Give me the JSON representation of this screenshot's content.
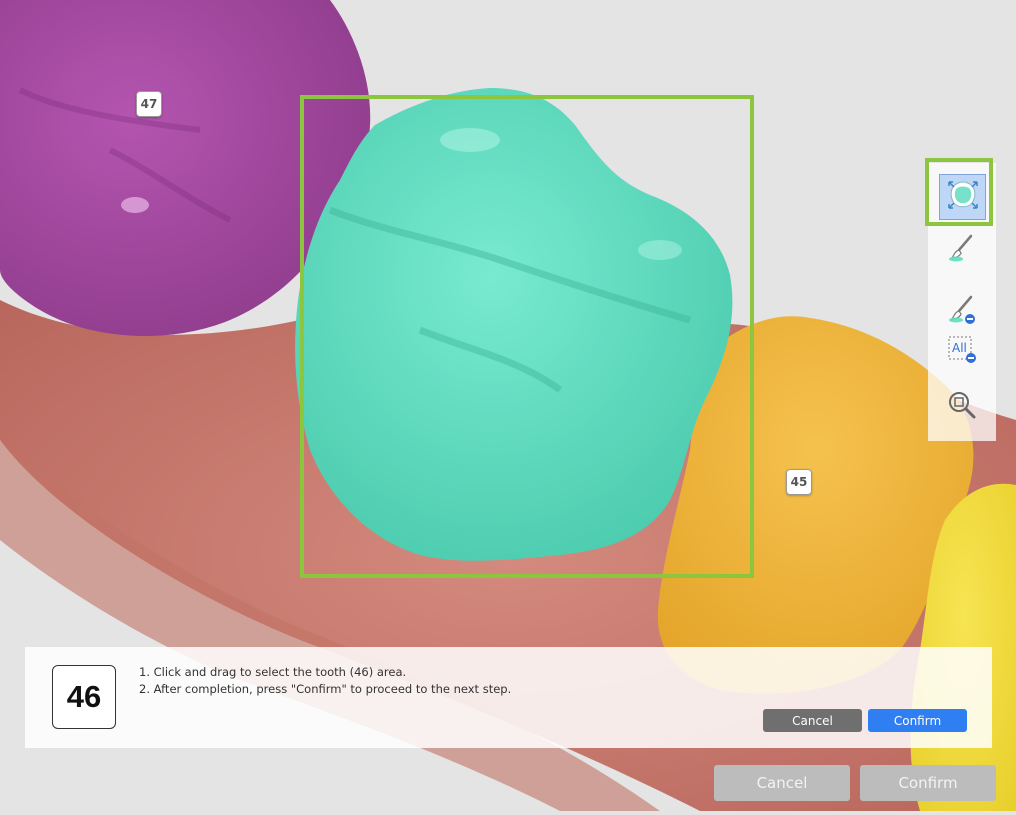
{
  "viewport": {
    "tooth_labels": {
      "t47": "47",
      "t45": "45"
    },
    "colors": {
      "tooth_47": "#a0479c",
      "tooth_46": "#5fdcbf",
      "tooth_45": "#eeb235",
      "tooth_44": "#f1dc3c",
      "gum": "#c8766a",
      "selection_box": "#8cc63f"
    }
  },
  "toolbar": {
    "tools": [
      {
        "icon": "select-tooth-icon",
        "active": true
      },
      {
        "icon": "brush-add-icon"
      },
      {
        "icon": "brush-remove-icon"
      },
      {
        "icon": "all-remove-icon",
        "text": "All"
      },
      {
        "icon": "zoom-fit-icon"
      }
    ],
    "accent": "#8cc63f"
  },
  "instruction_panel": {
    "step_number": "46",
    "instructions": [
      "1. Click and drag to select the tooth (46) area.",
      "2. After completion, press \"Confirm\" to proceed to the next step."
    ],
    "cancel_label": "Cancel",
    "confirm_label": "Confirm"
  },
  "footer": {
    "cancel_label": "Cancel",
    "confirm_label": "Confirm"
  }
}
